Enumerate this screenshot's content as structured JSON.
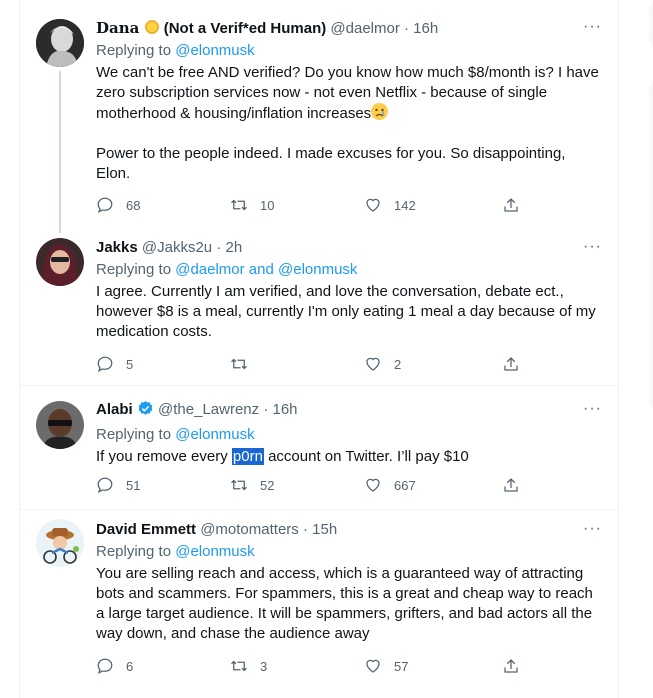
{
  "tweets": [
    {
      "name": "Dana",
      "name_suffix": "(Not a Verif*ed Human)",
      "handle": "@daelmor",
      "time": "16h",
      "replying_label": "Replying to",
      "replying_to": "@elonmusk",
      "text": "We can't be free AND verified? Do you know how much $8/month is? I have zero subscription services now - not even Netflix - because of single motherhood & housing/inflation increases",
      "text2": "Power to the people indeed. I made excuses for you. So disappointing, Elon.",
      "replies": "68",
      "retweets": "10",
      "likes": "142"
    },
    {
      "name": "Jakks",
      "handle": "@Jakks2u",
      "time": "2h",
      "replying_label": "Replying to",
      "replying_to": "@daelmor and @elonmusk",
      "text": "I agree. Currently I am verified, and love the conversation, debate ect., however $8 is a meal, currently I'm only eating 1 meal a day because of my medication costs.",
      "replies": "5",
      "retweets": "",
      "likes": "2"
    },
    {
      "name": "Alabi",
      "handle": "@the_Lawrenz",
      "time": "16h",
      "replying_label": "Replying to",
      "replying_to": "@elonmusk",
      "text_before": "If you remove every ",
      "text_highlight": "p0rn",
      "text_after": " account on Twitter. I’ll pay $10",
      "replies": "51",
      "retweets": "52",
      "likes": "667"
    },
    {
      "name": "David Emmett",
      "handle": "@motomatters",
      "time": "15h",
      "replying_label": "Replying to",
      "replying_to": "@elonmusk",
      "text": "You are selling reach and access, which is a guaranteed way of attracting bots and scammers. For spammers, this is a great and cheap way to reach a large target audience. It will be spammers, grifters, and bad actors all the way down, and chase the audience away",
      "replies": "6",
      "retweets": "3",
      "likes": "57"
    }
  ],
  "more_glyph": "···",
  "separator": "·",
  "colors": {
    "link": "#1d9bf0",
    "muted": "#536471",
    "verified": "#1d9bf0"
  }
}
